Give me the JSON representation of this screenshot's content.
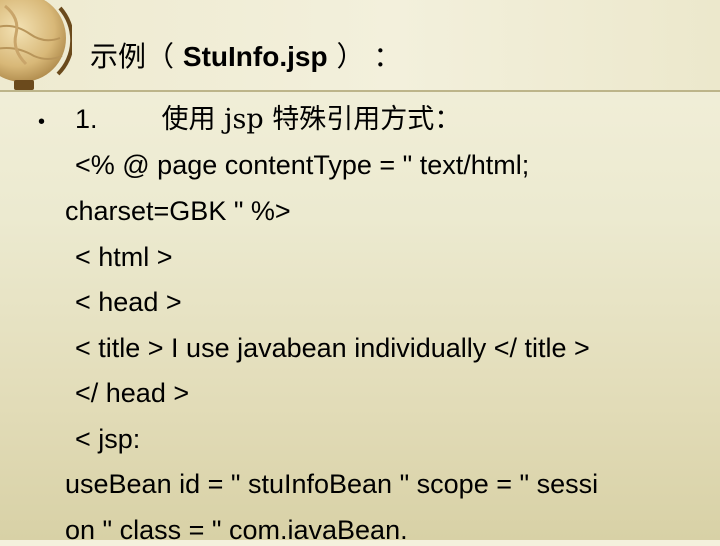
{
  "slide": {
    "title_prefix": "示例（ ",
    "title_file": "StuInfo.jsp",
    "title_suffix": " ） ：",
    "bullet": "•",
    "item_number": "1.",
    "item_heading": "使用 jsp 特殊引用方式：",
    "code_lines": [
      "<% @ page contentType = \" text/html;",
      "charset=GBK \"   %>",
      "< html >",
      "< head >",
      "< title > I use javabean individually </ title >",
      "</ head >",
      "< jsp:",
      "useBean id = \" stuInfoBean \"  scope = \" sessi",
      "on \"   class = \" com.iavaBean."
    ]
  },
  "colors": {
    "background_top": "#f4f1dd",
    "background_bottom": "#d8d1a6",
    "divider": "#bdb58a",
    "text": "#000000"
  },
  "icons": [
    "globe-icon"
  ]
}
